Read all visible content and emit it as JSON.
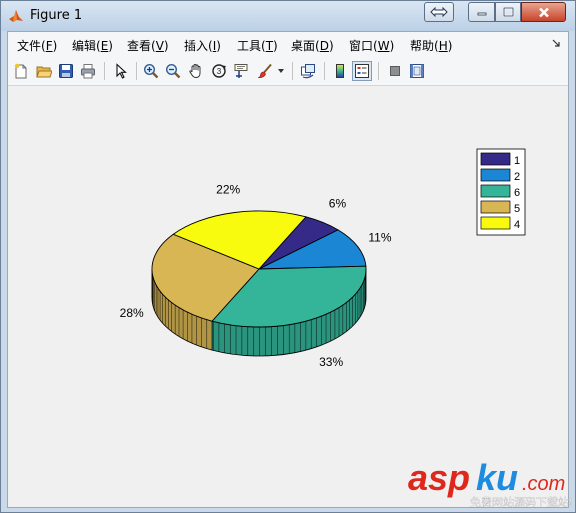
{
  "window": {
    "title": "Figure 1"
  },
  "menu": {
    "items": [
      {
        "label": "文件(",
        "key": "F",
        "end": ")"
      },
      {
        "label": "编辑(",
        "key": "E",
        "end": ")"
      },
      {
        "label": "查看(",
        "key": "V",
        "end": ")"
      },
      {
        "label": "插入(",
        "key": "I",
        "end": ")"
      },
      {
        "label": "工具(",
        "key": "T",
        "end": ")"
      },
      {
        "label": "桌面(",
        "key": "D",
        "end": ")"
      },
      {
        "label": "窗口(",
        "key": "W",
        "end": ")"
      },
      {
        "label": "帮助(",
        "key": "H",
        "end": ")"
      }
    ]
  },
  "toolbar": {
    "icons": [
      "new-figure-icon",
      "open-file-icon",
      "save-icon",
      "print-icon",
      "pointer-icon",
      "zoom-in-icon",
      "zoom-out-icon",
      "pan-hand-icon",
      "rotate-3d-icon",
      "data-cursor-icon",
      "brush-icon",
      "brush-dropdown-icon",
      "link-plot-icon",
      "colorbar-icon",
      "legend-icon",
      "hide-plot-tools-icon",
      "show-plot-tools-icon"
    ]
  },
  "chart_data": {
    "type": "pie",
    "three_d": true,
    "slices": [
      {
        "label": "1",
        "value": 6,
        "percent_label": "6%",
        "color": "#352a87"
      },
      {
        "label": "2",
        "value": 11,
        "percent_label": "11%",
        "color": "#1a86d4"
      },
      {
        "label": "6",
        "value": 33,
        "percent_label": "33%",
        "color": "#34b59a"
      },
      {
        "label": "5",
        "value": 28,
        "percent_label": "28%",
        "color": "#d8b654"
      },
      {
        "label": "4",
        "value": 22,
        "percent_label": "22%",
        "color": "#f9fb0e"
      }
    ],
    "legend": {
      "placement": "top-right",
      "entries": [
        "1",
        "2",
        "6",
        "5",
        "4"
      ]
    }
  },
  "watermark": {
    "brand_main": "asp",
    "brand_accent": "ku",
    "brand_suffix": ".com",
    "caption": "免费网站源码下载站!"
  },
  "colors": {
    "titlebar": "#c9d9ea",
    "figure_background": "#f0f0f0",
    "watermark_red": "#e0271c",
    "watermark_blue": "#1d8be0"
  }
}
